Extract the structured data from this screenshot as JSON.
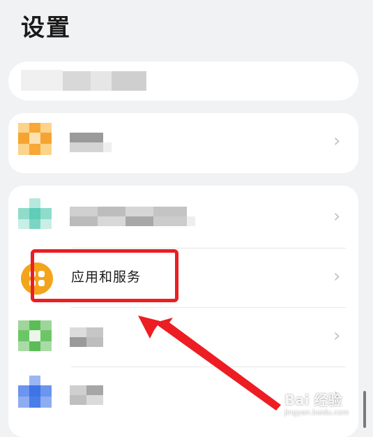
{
  "page": {
    "title": "设置"
  },
  "rows": [
    {
      "label": "应用和服务",
      "chevron": "›"
    }
  ],
  "chevron_glyph": "›",
  "watermark": {
    "brand": "Bai 经验",
    "site": "jingyan.baidu.com"
  },
  "colors": {
    "highlight": "#ec1d23",
    "apps_icon": "#f3a41b"
  },
  "icons": {
    "apps": "apps-grid-icon"
  }
}
